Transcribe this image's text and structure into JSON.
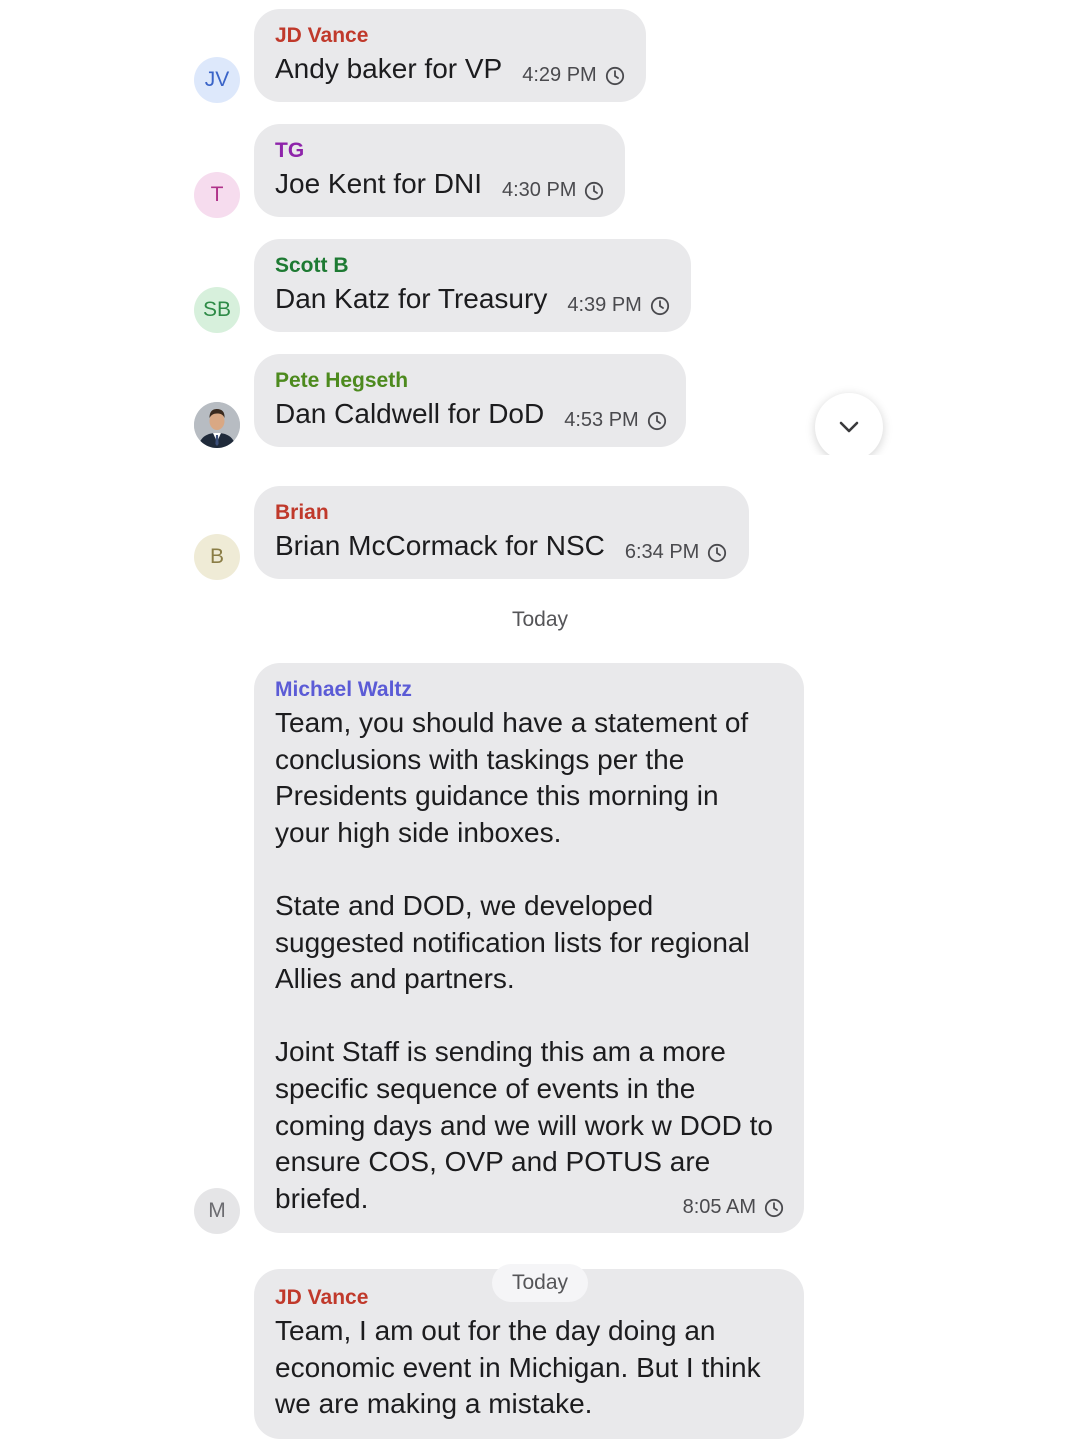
{
  "messages": [
    {
      "avatar": "JV",
      "avatar_bg": "#dde8fb",
      "avatar_fg": "#3a64c8",
      "sender": "JD Vance",
      "sender_color": "#c0392b",
      "text": "Andy baker for VP",
      "time": "4:29 PM",
      "status_icon": "clock-icon"
    },
    {
      "avatar": "T",
      "avatar_bg": "#f6dcee",
      "avatar_fg": "#b0328a",
      "sender": "TG",
      "sender_color": "#8e24aa",
      "text": "Joe Kent for DNI",
      "time": "4:30 PM",
      "status_icon": "clock-icon"
    },
    {
      "avatar": "SB",
      "avatar_bg": "#d7f0dc",
      "avatar_fg": "#2e8b47",
      "sender": "Scott B",
      "sender_color": "#1e7a33",
      "text": "Dan Katz for Treasury",
      "time": "4:39 PM",
      "status_icon": "clock-icon"
    },
    {
      "avatar": "photo",
      "sender": "Pete Hegseth",
      "sender_color": "#4d8a1e",
      "text": "Dan Caldwell for DoD",
      "time": "4:53 PM",
      "status_icon": "clock-icon"
    },
    {
      "avatar": "B",
      "avatar_bg": "#efebd6",
      "avatar_fg": "#8a7d45",
      "sender": "Brian",
      "sender_color": "#c0392b",
      "text": "Brian McCormack for NSC",
      "time": "6:34 PM",
      "status_icon": "clock-icon"
    }
  ],
  "day_separator_1": "Today",
  "waltz": {
    "avatar": "M",
    "sender": "Michael Waltz",
    "sender_color": "#5b5bd6",
    "paragraph_1": "Team, you should have a statement of\nconclusions with taskings per the\nPresidents guidance this morning in\nyour high side inboxes.",
    "paragraph_2": "State and DOD, we developed\nsuggested notification lists for regional\nAllies and partners.",
    "paragraph_3": "Joint Staff is sending this am a more\nspecific sequence of events in the\ncoming days and we will work w DOD to\nensure COS, OVP and POTUS are\nbriefed.",
    "time": "8:05 AM",
    "status_icon": "clock-icon"
  },
  "day_separator_2": "Today",
  "vance_last": {
    "sender": "JD Vance",
    "sender_color": "#c0392b",
    "text": "Team, I am out for the day doing an\neconomic event in Michigan. But I think\nwe are making a mistake."
  },
  "scroll_button_icon": "chevron-down-icon"
}
